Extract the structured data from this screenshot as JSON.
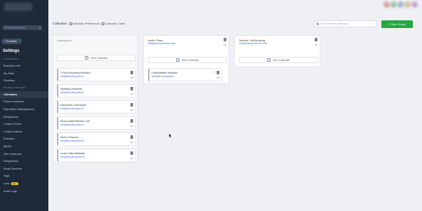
{
  "sidebar": {
    "go_back": "Go Back",
    "title": "Settings",
    "items": [
      {
        "label": "MY BUSINESS",
        "type": "section"
      },
      {
        "label": "Business Info"
      },
      {
        "label": "My Staff"
      },
      {
        "label": "Pipelines"
      },
      {
        "label": "BUSINESS SERVICES",
        "type": "section"
      },
      {
        "label": "Calendars",
        "active": true
      },
      {
        "label": "Phone Numbers"
      },
      {
        "label": "Reputation Management"
      },
      {
        "label": "Integrations"
      },
      {
        "label": "Custom Fields"
      },
      {
        "label": "Custom Values"
      },
      {
        "label": "Domains"
      },
      {
        "label": "Media"
      },
      {
        "label": "URL Redirects"
      },
      {
        "label": "Integrations"
      },
      {
        "label": "Email Services"
      },
      {
        "label": "Tags"
      },
      {
        "label": "Labs",
        "tag": "New"
      },
      {
        "label": "Audit Logs"
      }
    ]
  },
  "toolbar": {
    "label": "Calendars",
    "link1": "Calendar Preferences",
    "link2": "Calendar Guide"
  },
  "search": {
    "placeholder": "Type to search calendars"
  },
  "new_group_button": "+ New Group",
  "unassigned": {
    "header": "Unassigned",
    "new_calendar": "New Calendar",
    "calendars": [
      {
        "name": "1 Hour Booking Session",
        "url": "/widget/booking/demo1"
      },
      {
        "name": "Working Request",
        "url": "/widget/booking/demo2"
      },
      {
        "name": "Discovery Call Demo",
        "url": "/widget/booking/demo3"
      },
      {
        "name": "Book Audit Results Call",
        "url": "/widget/booking/demo4"
      },
      {
        "name": "Demo Session",
        "url": "/widget/booking/demo5"
      },
      {
        "name": "Lead Calls Wildside",
        "url": "/widget/booking/demo6"
      }
    ]
  },
  "groups": [
    {
      "name": "Andi's Team",
      "url": "/widget/group/andis-team",
      "new_calendar": "New Calendar",
      "calendars": [
        {
          "name": "Consultation Session",
          "url": "/widget/booking/team1",
          "count": "0"
        }
      ]
    },
    {
      "name": "Service Call Booking",
      "url": "/widget/group/service-call",
      "new_calendar": "New Calendar",
      "calendars": []
    }
  ],
  "colors": {
    "sidebar": "#1e2a38",
    "accent_green": "#27a844",
    "link": "#3a78c2"
  }
}
